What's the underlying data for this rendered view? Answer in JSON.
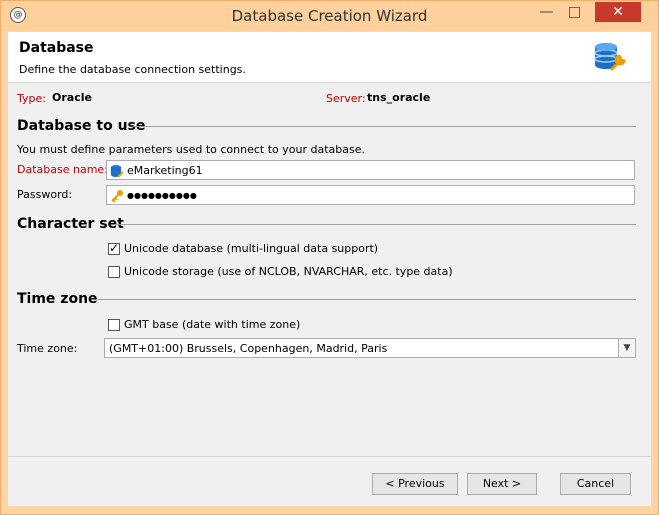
{
  "window": {
    "title": "Database Creation Wizard",
    "controls": {
      "minimize": "—",
      "maximize": "□",
      "close": "✕"
    }
  },
  "header": {
    "title": "Database",
    "subtitle": "Define the database connection settings."
  },
  "info": {
    "type_label": "Type:",
    "type_value": "Oracle",
    "server_label": "Server:",
    "server_value": "tns_oracle"
  },
  "db_section": {
    "title": "Database to use",
    "description": "You must define parameters used to connect to your database.",
    "db_name_label": "Database name:",
    "db_name_value": "eMarketing61",
    "password_label": "Password:",
    "password_value": "●●●●●●●●●●"
  },
  "charset_section": {
    "title": "Character set",
    "unicode_db": {
      "label": "Unicode database (multi-lingual data support)",
      "checked": true
    },
    "unicode_storage": {
      "label": "Unicode storage (use of NCLOB, NVARCHAR, etc. type data)",
      "checked": false
    }
  },
  "timezone_section": {
    "title": "Time zone",
    "gmt_base": {
      "label": "GMT base (date with time zone)",
      "checked": false
    },
    "tz_label": "Time zone:",
    "tz_value": "(GMT+01:00) Brussels, Copenhagen, Madrid, Paris"
  },
  "footer": {
    "previous": "< Previous",
    "next": "Next >",
    "cancel": "Cancel"
  },
  "colors": {
    "accent": "#c00000",
    "titlebar": "#fdd09c",
    "close": "#c7392b"
  },
  "icons": {
    "app": "app-logo-icon",
    "db": "database-wrench-icon",
    "dbfield": "database-small-icon",
    "key": "key-icon",
    "dropdown": "chevron-down-icon"
  }
}
